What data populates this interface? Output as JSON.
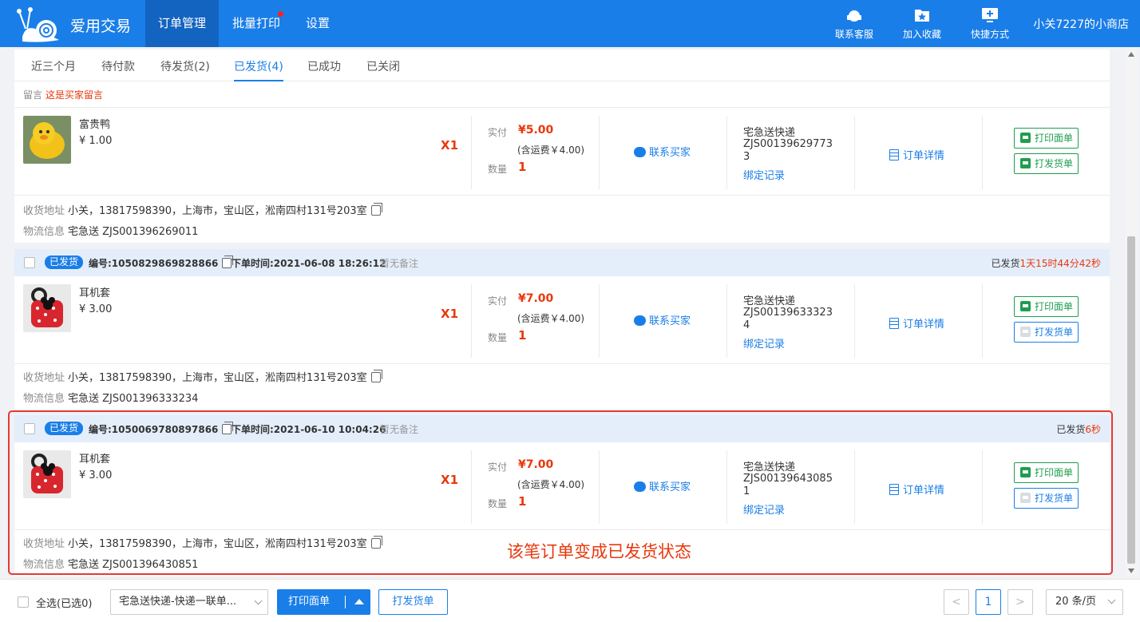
{
  "header": {
    "brand": "爱用交易",
    "nav": [
      {
        "label": "订单管理",
        "active": true
      },
      {
        "label": "批量打印",
        "active": false,
        "has_dot": true
      },
      {
        "label": "设置",
        "active": false
      }
    ],
    "tools": [
      {
        "label": "联系客服",
        "icon": "headset-icon"
      },
      {
        "label": "加入收藏",
        "icon": "star-folder-icon"
      },
      {
        "label": "快捷方式",
        "icon": "monitor-plus-icon"
      }
    ],
    "shop_name": "小关7227的小商店",
    "bar_color": "#1a7ee8"
  },
  "tabs": [
    {
      "label": "近三个月",
      "active": false
    },
    {
      "label": "待付款",
      "active": false
    },
    {
      "label": "待发货(2)",
      "active": false
    },
    {
      "label": "已发货(4)",
      "active": true
    },
    {
      "label": "已成功",
      "active": false
    },
    {
      "label": "已关闭",
      "active": false
    }
  ],
  "partial_order": {
    "remark_label": "留言",
    "remark_text": "这是买家留言",
    "product_name": "富贵鸭",
    "unit_price": "¥ 1.00",
    "qty_mark": "X1",
    "pay_label": "实付",
    "pay_amount": "¥5.00",
    "shipping_fee": "(含运费￥4.00)",
    "count_label": "数量",
    "count": "1",
    "contact": "联系买家",
    "carrier": "宅急送快递",
    "tracking_no": "ZJS001396297733",
    "bind_record": "绑定记录",
    "detail": "订单详情",
    "print_waybill": "打印面单",
    "print_shipping": "打发货单",
    "addr_label": "收货地址",
    "address": "小关，13817598390，上海市，宝山区，淞南四村131号203室",
    "logi_label": "物流信息",
    "logistics": "宅急送 ZJS001396269011"
  },
  "orders": [
    {
      "status_badge": "已发货",
      "order_no": "编号:1050829869828866",
      "order_time": "下单时间:2021-06-08 18:26:12",
      "note": "暂无备注",
      "status_prefix": "已发货",
      "status_elapsed": "1天15时44分42秒",
      "product_name": "耳机套",
      "unit_price": "¥ 3.00",
      "qty_mark": "X1",
      "pay_label": "实付",
      "pay_amount": "¥7.00",
      "shipping_fee": "(含运费￥4.00)",
      "count_label": "数量",
      "count": "1",
      "contact": "联系买家",
      "carrier": "宅急送快递",
      "tracking_no": "ZJS001396333234",
      "bind_record": "绑定记录",
      "detail": "订单详情",
      "print_waybill": "打印面单",
      "print_shipping": "打发货单",
      "addr_label": "收货地址",
      "address": "小关，13817598390，上海市，宝山区，淞南四村131号203室",
      "logi_label": "物流信息",
      "logistics": "宅急送 ZJS001396333234"
    },
    {
      "status_badge": "已发货",
      "order_no": "编号:1050069780897866",
      "order_time": "下单时间:2021-06-10 10:04:26",
      "note": "暂无备注",
      "status_prefix": "已发货",
      "status_elapsed": "6秒",
      "product_name": "耳机套",
      "unit_price": "¥ 3.00",
      "qty_mark": "X1",
      "pay_label": "实付",
      "pay_amount": "¥7.00",
      "shipping_fee": "(含运费￥4.00)",
      "count_label": "数量",
      "count": "1",
      "contact": "联系买家",
      "carrier": "宅急送快递",
      "tracking_no": "ZJS001396430851",
      "bind_record": "绑定记录",
      "detail": "订单详情",
      "print_waybill": "打印面单",
      "print_shipping": "打发货单",
      "addr_label": "收货地址",
      "address": "小关，13817598390，上海市，宝山区，淞南四村131号203室",
      "logi_label": "物流信息",
      "logistics": "宅急送 ZJS001396430851"
    }
  ],
  "annotation": "该笔订单变成已发货状态",
  "footer": {
    "select_all": "全选(已选0)",
    "template": "宅急送快递-快递一联单...",
    "print_waybill": "打印面单",
    "print_shipping": "打发货单",
    "prev": "<",
    "page": "1",
    "next": ">",
    "page_size": "20 条/页"
  },
  "colors": {
    "accent": "#1a7ee8",
    "price_red": "#e8380d",
    "green_button": "#1e9e4e",
    "highlight_border": "#e53935"
  }
}
